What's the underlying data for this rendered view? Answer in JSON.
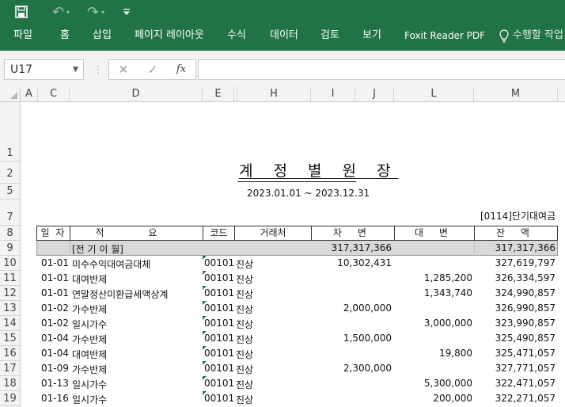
{
  "qat": {
    "save": "save-icon",
    "undo": "undo-icon",
    "redo": "redo-icon",
    "more": "customize-qat-icon"
  },
  "ribbon": {
    "tabs": [
      "파일",
      "홈",
      "삽입",
      "페이지 레이아웃",
      "수식",
      "데이터",
      "검토",
      "보기",
      "Foxit Reader PDF"
    ],
    "search": "수행할 작업"
  },
  "formula": {
    "namebox": "U17",
    "cancel": "✕",
    "enter": "✓",
    "fx": "fx",
    "value": ""
  },
  "columns": [
    "A",
    "C",
    "D",
    "E",
    "H",
    "I",
    "J",
    "L",
    "M"
  ],
  "rows": [
    "1",
    "2",
    "5",
    "7",
    "8",
    "9",
    "10",
    "11",
    "12",
    "13",
    "14",
    "15",
    "16",
    "17",
    "18",
    "19"
  ],
  "report": {
    "title": "계 정 별 원 장",
    "period": "2023.01.01 ~ 2023.12.31",
    "account": "[0114]단기대여금",
    "headers": {
      "date": "일 자",
      "desc": "적 요",
      "code": "코드",
      "partner": "거래처",
      "debit": "차 변",
      "credit": "대 변",
      "balance": "잔 액"
    },
    "carryover": {
      "label": "[전 기 이 월]",
      "debit": "317,317,366",
      "balance": "317,317,366"
    },
    "entries": [
      {
        "date": "01-01",
        "desc": "미수수익대여금대체",
        "code": "00101",
        "partner": "진상",
        "debit": "10,302,431",
        "credit": "",
        "balance": "327,619,797"
      },
      {
        "date": "01-01",
        "desc": "대여반제",
        "code": "00101",
        "partner": "진상",
        "debit": "",
        "credit": "1,285,200",
        "balance": "326,334,597"
      },
      {
        "date": "01-01",
        "desc": "연말정산미환급세액상계",
        "code": "00101",
        "partner": "진상",
        "debit": "",
        "credit": "1,343,740",
        "balance": "324,990,857"
      },
      {
        "date": "01-02",
        "desc": "가수반제",
        "code": "00101",
        "partner": "진상",
        "debit": "2,000,000",
        "credit": "",
        "balance": "326,990,857"
      },
      {
        "date": "01-02",
        "desc": "일시가수",
        "code": "00101",
        "partner": "진상",
        "debit": "",
        "credit": "3,000,000",
        "balance": "323,990,857"
      },
      {
        "date": "01-04",
        "desc": "가수반제",
        "code": "00101",
        "partner": "진상",
        "debit": "1,500,000",
        "credit": "",
        "balance": "325,490,857"
      },
      {
        "date": "01-04",
        "desc": "대여반제",
        "code": "00101",
        "partner": "진상",
        "debit": "",
        "credit": "19,800",
        "balance": "325,471,057"
      },
      {
        "date": "01-09",
        "desc": "가수반제",
        "code": "00101",
        "partner": "진상",
        "debit": "2,300,000",
        "credit": "",
        "balance": "327,771,057"
      },
      {
        "date": "01-13",
        "desc": "일시가수",
        "code": "00101",
        "partner": "진상",
        "debit": "",
        "credit": "5,300,000",
        "balance": "322,471,057"
      },
      {
        "date": "01-16",
        "desc": "일시가수",
        "code": "00101",
        "partner": "진상",
        "debit": "",
        "credit": "200,000",
        "balance": "322,271,057"
      }
    ]
  },
  "colors": {
    "ribbon": "#217346",
    "header_bg": "#f3f3f3",
    "carryover_bg": "#d9d9d9",
    "error_marker": "#1e7a3a"
  }
}
